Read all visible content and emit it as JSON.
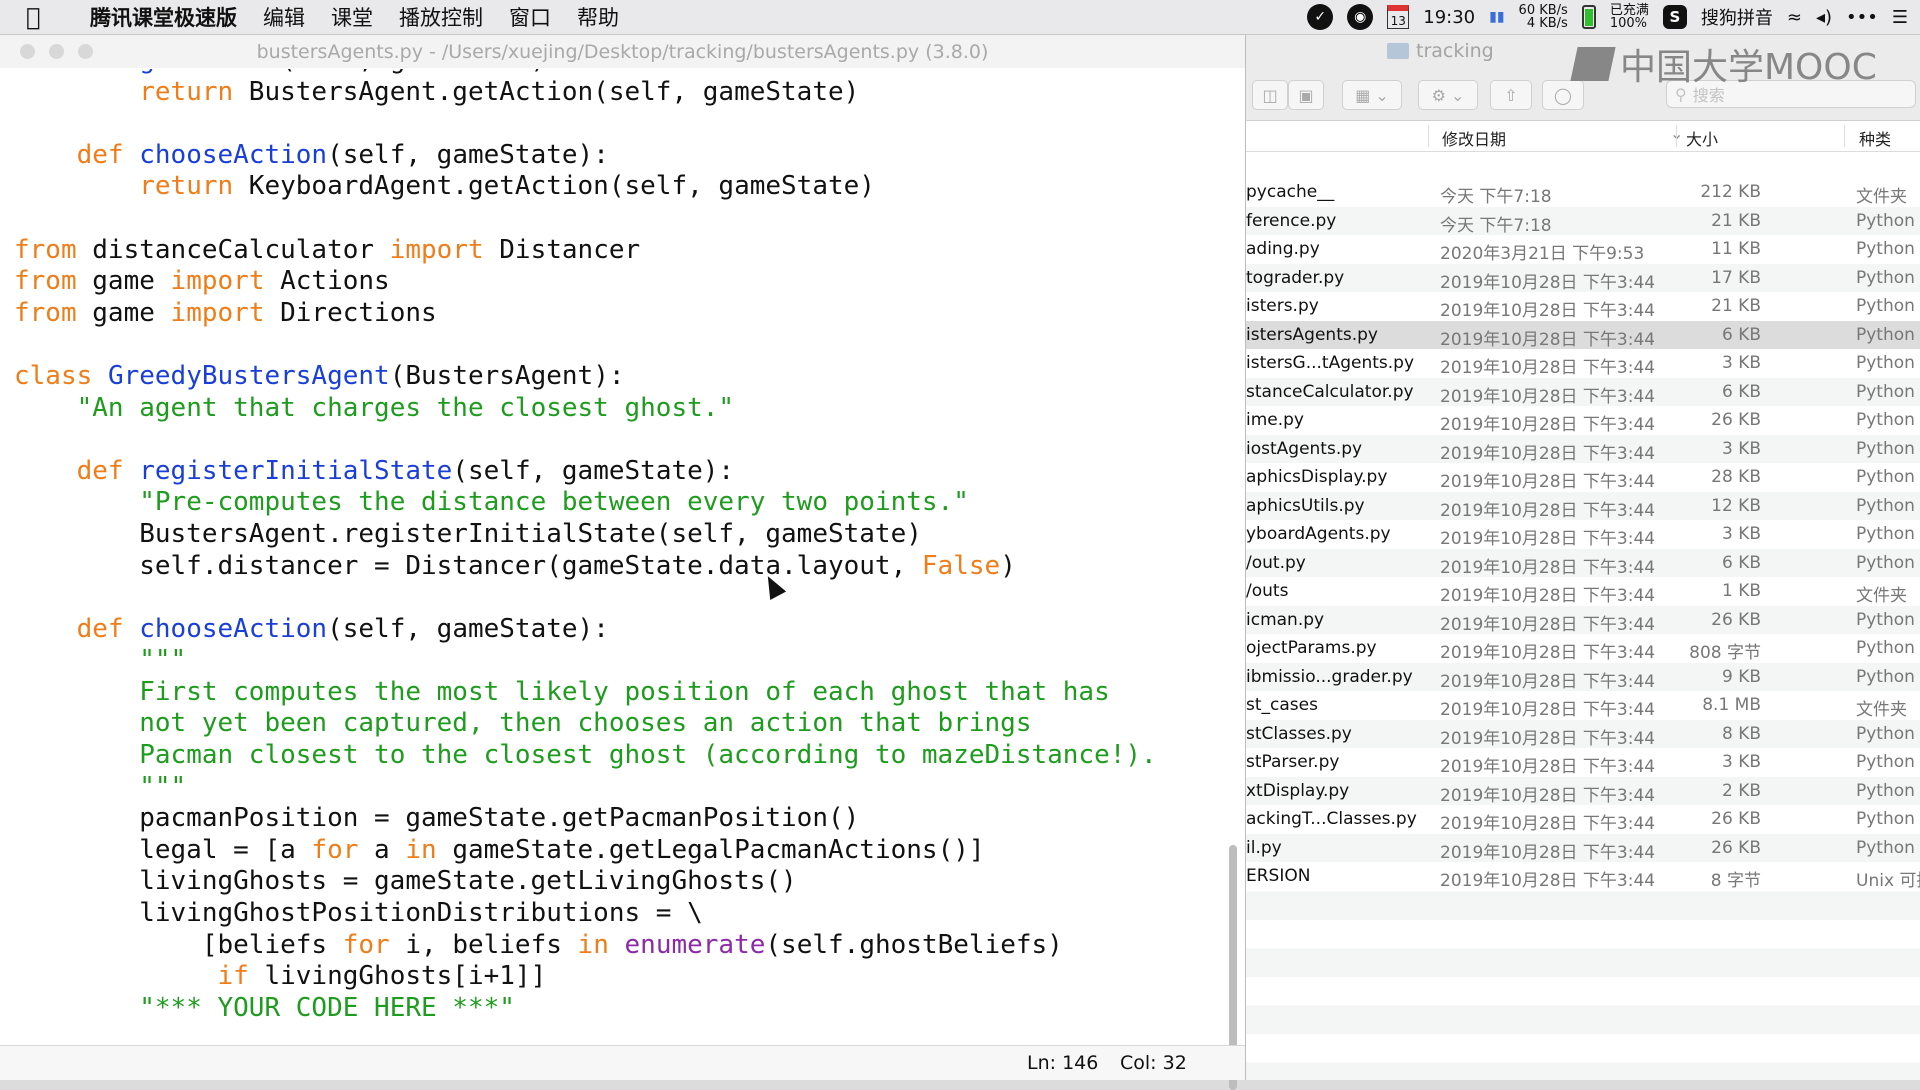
{
  "menubar": {
    "app_name": "腾讯课堂极速版",
    "items": [
      "编辑",
      "课堂",
      "播放控制",
      "窗口",
      "帮助"
    ],
    "calendar_day": "13",
    "time": "19:30",
    "net_up": "60 KB/s",
    "net_down": "4 KB/s",
    "battery_line1": "已充满",
    "battery_line2": "100%",
    "ime_label": "搜狗拼音",
    "icons": [
      "apple-icon",
      "status-app-icon",
      "status-app2-icon",
      "calendar-icon",
      "net-icon",
      "battery-icon",
      "ime-icon",
      "wifi-icon",
      "volume-icon",
      "more-icon",
      "list-icon"
    ]
  },
  "editor": {
    "title": "bustersAgents.py - /Users/xuejing/Desktop/tracking/bustersAgents.py (3.8.0)",
    "status_ln": "Ln: 146",
    "status_col": "Col: 32",
    "lines": [
      [
        [
          "    ",
          ""
        ],
        [
          "def",
          "kw"
        ],
        [
          " ",
          ""
        ],
        [
          "getAction",
          "fn"
        ],
        [
          "(self, gameState):",
          ""
        ]
      ],
      [
        [
          "        ",
          ""
        ],
        [
          "return",
          "kw"
        ],
        [
          " BustersAgent.getAction(self, gameState)",
          ""
        ]
      ],
      [
        [
          "",
          ""
        ]
      ],
      [
        [
          "    ",
          ""
        ],
        [
          "def",
          "kw"
        ],
        [
          " ",
          ""
        ],
        [
          "chooseAction",
          "fn"
        ],
        [
          "(self, gameState):",
          ""
        ]
      ],
      [
        [
          "        ",
          ""
        ],
        [
          "return",
          "kw"
        ],
        [
          " KeyboardAgent.getAction(self, gameState)",
          ""
        ]
      ],
      [
        [
          "",
          ""
        ]
      ],
      [
        [
          "from",
          "kw"
        ],
        [
          " distanceCalculator ",
          ""
        ],
        [
          "import",
          "kw"
        ],
        [
          " Distancer",
          ""
        ]
      ],
      [
        [
          "from",
          "kw"
        ],
        [
          " game ",
          ""
        ],
        [
          "import",
          "kw"
        ],
        [
          " Actions",
          ""
        ]
      ],
      [
        [
          "from",
          "kw"
        ],
        [
          " game ",
          ""
        ],
        [
          "import",
          "kw"
        ],
        [
          " Directions",
          ""
        ]
      ],
      [
        [
          "",
          ""
        ]
      ],
      [
        [
          "class",
          "kw"
        ],
        [
          " ",
          ""
        ],
        [
          "GreedyBustersAgent",
          "fn"
        ],
        [
          "(BustersAgent):",
          ""
        ]
      ],
      [
        [
          "    ",
          ""
        ],
        [
          "\"An agent that charges the closest ghost.\"",
          "str"
        ]
      ],
      [
        [
          "",
          ""
        ]
      ],
      [
        [
          "    ",
          ""
        ],
        [
          "def",
          "kw"
        ],
        [
          " ",
          ""
        ],
        [
          "registerInitialState",
          "fn"
        ],
        [
          "(self, gameState):",
          ""
        ]
      ],
      [
        [
          "        ",
          ""
        ],
        [
          "\"Pre-computes the distance between every two points.\"",
          "str"
        ]
      ],
      [
        [
          "        BustersAgent.registerInitialState(self, gameState)",
          ""
        ]
      ],
      [
        [
          "        self.distancer = Distancer(gameState.data.layout, ",
          ""
        ],
        [
          "False",
          "kw"
        ],
        [
          ")",
          ""
        ]
      ],
      [
        [
          "",
          ""
        ]
      ],
      [
        [
          "    ",
          ""
        ],
        [
          "def",
          "kw"
        ],
        [
          " ",
          ""
        ],
        [
          "chooseAction",
          "fn"
        ],
        [
          "(self, gameState):",
          ""
        ]
      ],
      [
        [
          "        ",
          ""
        ],
        [
          "\"\"\"",
          "str"
        ]
      ],
      [
        [
          "        ",
          ""
        ],
        [
          "First computes the most likely position of each ghost that has",
          "str"
        ]
      ],
      [
        [
          "        ",
          ""
        ],
        [
          "not yet been captured, then chooses an action that brings",
          "str"
        ]
      ],
      [
        [
          "        ",
          ""
        ],
        [
          "Pacman closest to the closest ghost (according to mazeDistance!).",
          "str"
        ]
      ],
      [
        [
          "        ",
          ""
        ],
        [
          "\"\"\"",
          "str"
        ]
      ],
      [
        [
          "        pacmanPosition = gameState.getPacmanPosition()",
          ""
        ]
      ],
      [
        [
          "        legal = [a ",
          ""
        ],
        [
          "for",
          "kw"
        ],
        [
          " a ",
          ""
        ],
        [
          "in",
          "kw"
        ],
        [
          " gameState.getLegalPacmanActions()]",
          ""
        ]
      ],
      [
        [
          "        livingGhosts = gameState.getLivingGhosts()",
          ""
        ]
      ],
      [
        [
          "        livingGhostPositionDistributions = \\",
          ""
        ]
      ],
      [
        [
          "            [beliefs ",
          ""
        ],
        [
          "for",
          "kw"
        ],
        [
          " i, beliefs ",
          ""
        ],
        [
          "in",
          "kw"
        ],
        [
          " ",
          ""
        ],
        [
          "enumerate",
          "bi"
        ],
        [
          "(self.ghostBeliefs)",
          ""
        ]
      ],
      [
        [
          "             ",
          ""
        ],
        [
          "if",
          "kw"
        ],
        [
          " livingGhosts[i+1]]",
          ""
        ]
      ],
      [
        [
          "        ",
          ""
        ],
        [
          "\"*** YOUR CODE HERE ***\"",
          "str"
        ]
      ]
    ]
  },
  "finder": {
    "title": "tracking",
    "search_placeholder": "搜索",
    "col_date": "修改日期",
    "col_size": "大小",
    "col_kind": "种类",
    "selected_index": 5,
    "files": [
      {
        "name": "pycache__",
        "date": "今天 下午7:18",
        "size": "212 KB",
        "kind": "文件夹"
      },
      {
        "name": "ference.py",
        "date": "今天 下午7:18",
        "size": "21 KB",
        "kind": "Python"
      },
      {
        "name": "ading.py",
        "date": "2020年3月21日 下午9:53",
        "size": "11 KB",
        "kind": "Python"
      },
      {
        "name": "tograder.py",
        "date": "2019年10月28日 下午3:44",
        "size": "17 KB",
        "kind": "Python"
      },
      {
        "name": "isters.py",
        "date": "2019年10月28日 下午3:44",
        "size": "21 KB",
        "kind": "Python"
      },
      {
        "name": "istersAgents.py",
        "date": "2019年10月28日 下午3:44",
        "size": "6 KB",
        "kind": "Python"
      },
      {
        "name": "istersG...tAgents.py",
        "date": "2019年10月28日 下午3:44",
        "size": "3 KB",
        "kind": "Python"
      },
      {
        "name": "stanceCalculator.py",
        "date": "2019年10月28日 下午3:44",
        "size": "6 KB",
        "kind": "Python"
      },
      {
        "name": "ime.py",
        "date": "2019年10月28日 下午3:44",
        "size": "26 KB",
        "kind": "Python"
      },
      {
        "name": "iostAgents.py",
        "date": "2019年10月28日 下午3:44",
        "size": "3 KB",
        "kind": "Python"
      },
      {
        "name": "aphicsDisplay.py",
        "date": "2019年10月28日 下午3:44",
        "size": "28 KB",
        "kind": "Python"
      },
      {
        "name": "aphicsUtils.py",
        "date": "2019年10月28日 下午3:44",
        "size": "12 KB",
        "kind": "Python"
      },
      {
        "name": "yboardAgents.py",
        "date": "2019年10月28日 下午3:44",
        "size": "3 KB",
        "kind": "Python"
      },
      {
        "name": "/out.py",
        "date": "2019年10月28日 下午3:44",
        "size": "6 KB",
        "kind": "Python"
      },
      {
        "name": "/outs",
        "date": "2019年10月28日 下午3:44",
        "size": "1 KB",
        "kind": "文件夹"
      },
      {
        "name": "icman.py",
        "date": "2019年10月28日 下午3:44",
        "size": "26 KB",
        "kind": "Python"
      },
      {
        "name": "ojectParams.py",
        "date": "2019年10月28日 下午3:44",
        "size": "808 字节",
        "kind": "Python"
      },
      {
        "name": "ibmissio...grader.py",
        "date": "2019年10月28日 下午3:44",
        "size": "9 KB",
        "kind": "Python"
      },
      {
        "name": "st_cases",
        "date": "2019年10月28日 下午3:44",
        "size": "8.1 MB",
        "kind": "文件夹"
      },
      {
        "name": "stClasses.py",
        "date": "2019年10月28日 下午3:44",
        "size": "8 KB",
        "kind": "Python"
      },
      {
        "name": "stParser.py",
        "date": "2019年10月28日 下午3:44",
        "size": "3 KB",
        "kind": "Python"
      },
      {
        "name": "xtDisplay.py",
        "date": "2019年10月28日 下午3:44",
        "size": "2 KB",
        "kind": "Python"
      },
      {
        "name": "ackingT...Classes.py",
        "date": "2019年10月28日 下午3:44",
        "size": "26 KB",
        "kind": "Python"
      },
      {
        "name": "il.py",
        "date": "2019年10月28日 下午3:44",
        "size": "26 KB",
        "kind": "Python"
      },
      {
        "name": "ERSION",
        "date": "2019年10月28日 下午3:44",
        "size": "8 字节",
        "kind": "Unix 可执"
      }
    ]
  },
  "watermark": {
    "text": "中国大学MOOC"
  }
}
